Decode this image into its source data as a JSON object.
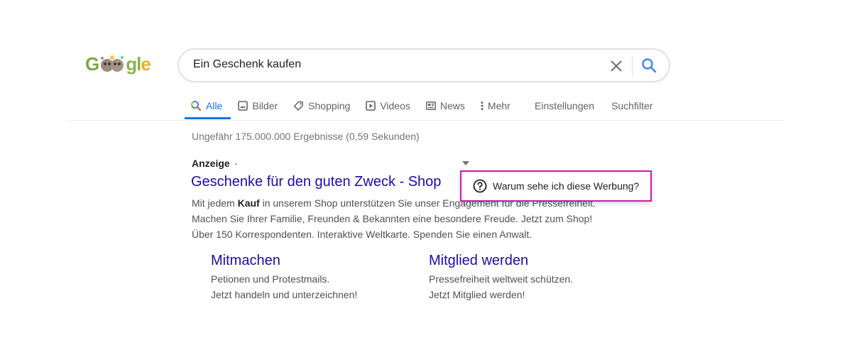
{
  "logo": {
    "letters_left": "G",
    "letters_right": "gl",
    "letter_end": "e"
  },
  "search": {
    "query": "Ein Geschenk kaufen",
    "clear_icon": "close-icon",
    "submit_icon": "search-icon"
  },
  "tabs": {
    "all": "Alle",
    "images": "Bilder",
    "shopping": "Shopping",
    "videos": "Videos",
    "news": "News",
    "more": "Mehr",
    "settings": "Einstellungen",
    "tools": "Suchfilter"
  },
  "results": {
    "stats": "Ungefähr 175.000.000 Ergebnisse (0,59 Sekunden)"
  },
  "ad": {
    "label": "Anzeige",
    "separator": "·",
    "title": "Geschenke für den guten Zweck - Shop",
    "desc_line1_pre": "Mit jedem ",
    "desc_line1_bold": "Kauf",
    "desc_line1_post": " in unserem Shop unterstützen Sie unser Engagement für die Pressefreiheit.",
    "desc_line2": "Machen Sie Ihrer Familie, Freunden & Bekannten eine besondere Freude. Jetzt zum Shop!",
    "desc_line3": "Über 150 Korrespondenten. Interaktive Weltkarte. Spenden Sie einen Anwalt.",
    "sitelinks": [
      {
        "title": "Mitmachen",
        "line1": "Petionen und Protestmails.",
        "line2": "Jetzt handeln und unterzeichnen!"
      },
      {
        "title": "Mitglied werden",
        "line1": "Pressefreiheit weltweit schützen.",
        "line2": "Jetzt Mitglied werden!"
      }
    ],
    "why_popup": "Warum sehe ich diese Werbung?"
  },
  "colors": {
    "link": "#1a0dab",
    "accent": "#1a73e8",
    "popup_border": "#d11aa5"
  }
}
